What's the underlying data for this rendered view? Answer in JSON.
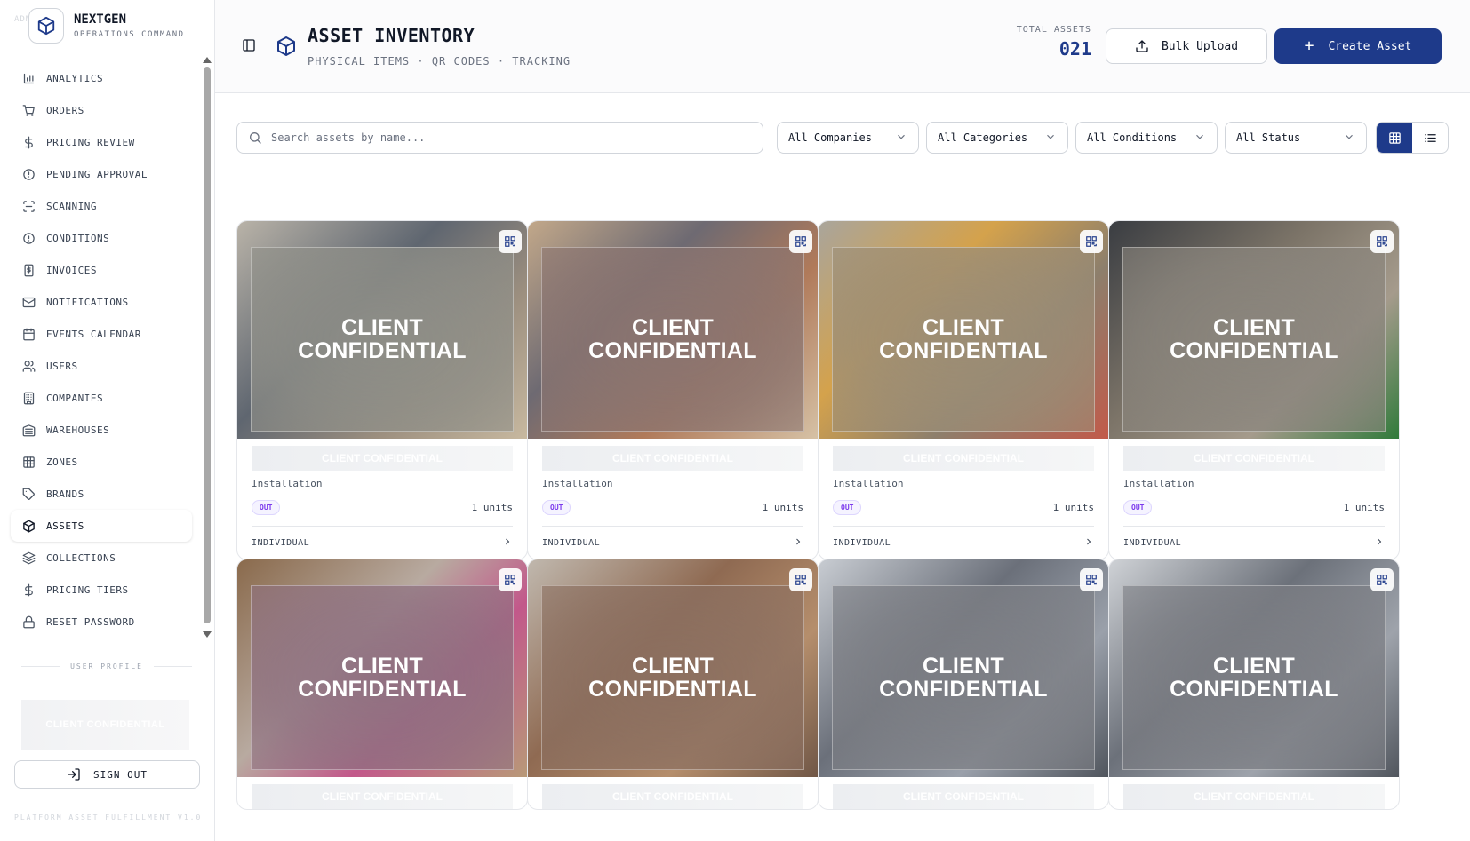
{
  "sidebar": {
    "ghost_text": "ADMIN 81",
    "brand_name": "NEXTGEN",
    "brand_sub": "OPERATIONS COMMAND",
    "items": [
      {
        "label": "ANALYTICS",
        "icon": "bar-chart-icon"
      },
      {
        "label": "ORDERS",
        "icon": "cart-icon"
      },
      {
        "label": "PRICING REVIEW",
        "icon": "dollar-icon"
      },
      {
        "label": "PENDING APPROVAL",
        "icon": "alert-circle-icon"
      },
      {
        "label": "SCANNING",
        "icon": "scan-icon"
      },
      {
        "label": "CONDITIONS",
        "icon": "alert-circle-icon"
      },
      {
        "label": "INVOICES",
        "icon": "invoice-icon"
      },
      {
        "label": "NOTIFICATIONS",
        "icon": "mail-icon"
      },
      {
        "label": "EVENTS CALENDAR",
        "icon": "calendar-icon"
      },
      {
        "label": "USERS",
        "icon": "users-icon"
      },
      {
        "label": "COMPANIES",
        "icon": "building-icon"
      },
      {
        "label": "WAREHOUSES",
        "icon": "warehouse-icon"
      },
      {
        "label": "ZONES",
        "icon": "grid-icon"
      },
      {
        "label": "BRANDS",
        "icon": "tag-icon"
      },
      {
        "label": "ASSETS",
        "icon": "cube-icon",
        "active": true
      },
      {
        "label": "COLLECTIONS",
        "icon": "layers-icon"
      },
      {
        "label": "PRICING TIERS",
        "icon": "dollar-icon"
      },
      {
        "label": "RESET PASSWORD",
        "icon": "lock-icon"
      }
    ],
    "profile_label": "USER PROFILE",
    "profile_name": "CLIENT CONFIDENTIAL",
    "sign_out": "SIGN OUT",
    "footer": "PLATFORM ASSET FULFILLMENT V1.0"
  },
  "header": {
    "title": "ASSET INVENTORY",
    "subtitle": "PHYSICAL ITEMS · QR CODES · TRACKING",
    "total_label": "TOTAL ASSETS",
    "total_value": "021",
    "bulk_upload": "Bulk Upload",
    "create_asset": "Create Asset"
  },
  "filters": {
    "search_placeholder": "Search assets by name...",
    "companies": "All Companies",
    "categories": "All Categories",
    "conditions": "All Conditions",
    "status": "All Status"
  },
  "assets": [
    {
      "overlay": "CLIENT CONFIDENTIAL",
      "name": "CLIENT CONFIDENTIAL",
      "category": "Installation",
      "status": "OUT",
      "units": "1 units",
      "tracking": "INDIVIDUAL",
      "tint": "#8f8f88"
    },
    {
      "overlay": "CLIENT CONFIDENTIAL",
      "name": "CLIENT CONFIDENTIAL",
      "category": "Installation",
      "status": "OUT",
      "units": "1 units",
      "tracking": "INDIVIDUAL",
      "tint": "#8a7470"
    },
    {
      "overlay": "CLIENT CONFIDENTIAL",
      "name": "CLIENT CONFIDENTIAL",
      "category": "Installation",
      "status": "OUT",
      "units": "1 units",
      "tracking": "INDIVIDUAL",
      "tint": "#9b8d76"
    },
    {
      "overlay": "CLIENT CONFIDENTIAL",
      "name": "CLIENT CONFIDENTIAL",
      "category": "Installation",
      "status": "OUT",
      "units": "1 units",
      "tracking": "INDIVIDUAL",
      "tint": "#8a857d"
    },
    {
      "overlay": "CLIENT CONFIDENTIAL",
      "name": "CLIENT CONFIDENTIAL",
      "category": "",
      "status": "",
      "units": "",
      "tracking": "",
      "tint": "#8e7080"
    },
    {
      "overlay": "CLIENT CONFIDENTIAL",
      "name": "CLIENT CONFIDENTIAL",
      "category": "",
      "status": "",
      "units": "",
      "tracking": "",
      "tint": "#8b6f60"
    },
    {
      "overlay": "CLIENT CONFIDENTIAL",
      "name": "CLIENT CONFIDENTIAL",
      "category": "",
      "status": "",
      "units": "",
      "tracking": "",
      "tint": "#7c7e84"
    },
    {
      "overlay": "CLIENT CONFIDENTIAL",
      "name": "CLIENT CONFIDENTIAL",
      "category": "",
      "status": "",
      "units": "",
      "tracking": "",
      "tint": "#7b7d83"
    }
  ],
  "colors": {
    "primary": "#1e3a8a",
    "badge": "#7c3aed"
  }
}
